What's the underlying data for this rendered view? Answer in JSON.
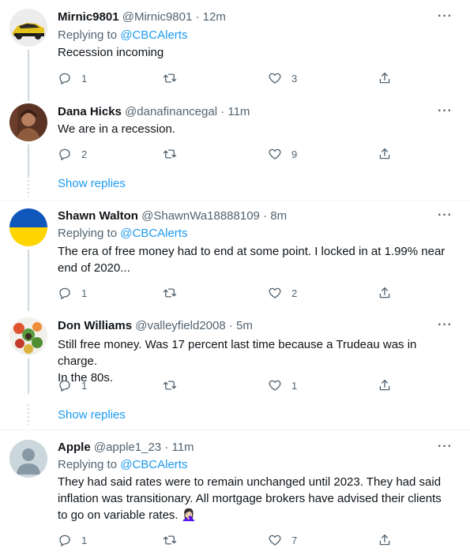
{
  "tweets": [
    {
      "name": "Mirnic9801",
      "handle": "@Mirnic9801",
      "time": "· 12m",
      "replying_prefix": "Replying to ",
      "replying_handle": "@CBCAlerts",
      "text": "Recession incoming",
      "replies": "1",
      "retweets": "",
      "likes": "3",
      "avatar_icon": "camaro-car-avatar"
    },
    {
      "name": "Dana Hicks",
      "handle": "@danafinancegal",
      "time": "· 11m",
      "text": "We are in a recession.",
      "replies": "2",
      "retweets": "",
      "likes": "9",
      "avatar_icon": "person-photo-avatar"
    },
    {
      "name": "Shawn Walton",
      "handle": "@ShawnWa18888109",
      "time": "· 8m",
      "replying_prefix": "Replying to ",
      "replying_handle": "@CBCAlerts",
      "text_line1": "The era of free money had to end at some point.  I locked in at 1.99% near",
      "text_line2": "end of 2020...",
      "replies": "1",
      "retweets": "",
      "likes": "2",
      "avatar_icon": "ukraine-flag-avatar"
    },
    {
      "name": "Don Williams",
      "handle": "@valleyfield2008",
      "time": "· 5m",
      "text_line1": "Still free money. Was 17 percent last time because a Trudeau was in charge.",
      "text_line2": "In the 80s.",
      "replies": "1",
      "retweets": "",
      "likes": "1",
      "avatar_icon": "flowers-photo-avatar"
    },
    {
      "name": "Apple",
      "handle": "@apple1_23",
      "time": "· 11m",
      "replying_prefix": "Replying to ",
      "replying_handle": "@CBCAlerts",
      "text_line1": "They had said rates were to remain unchanged until 2023. They had said",
      "text_line2": "inflation was transitionary. All mortgage brokers have advised their clients",
      "text_line3": "to go on variable rates. 🤦🏻‍♀️",
      "replies": "1",
      "retweets": "",
      "likes": "7",
      "avatar_icon": "default-person-avatar"
    }
  ],
  "show_replies_label": "Show replies",
  "more_label": "···",
  "colors": {
    "accent": "#1d9bf0",
    "muted": "#536471",
    "text": "#0f1419",
    "thread_line": "#cfd9de"
  }
}
